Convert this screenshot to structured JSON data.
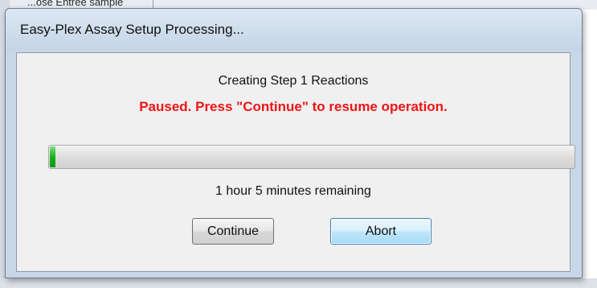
{
  "background": {
    "fragment_text": "...ose Entrée sample"
  },
  "dialog": {
    "title": "Easy-Plex Assay Setup Processing...",
    "status": "Creating Step 1 Reactions",
    "paused_message": "Paused. Press \"Continue\" to resume operation.",
    "progress": {
      "fraction": 0.01
    },
    "time_remaining": "1 hour 5 minutes remaining",
    "buttons": {
      "continue_label": "Continue",
      "abort_label": "Abort"
    }
  },
  "colors": {
    "paused_text": "#f01515",
    "progress_fill": "#19b21a",
    "title_bar": "#c8d7e6"
  }
}
